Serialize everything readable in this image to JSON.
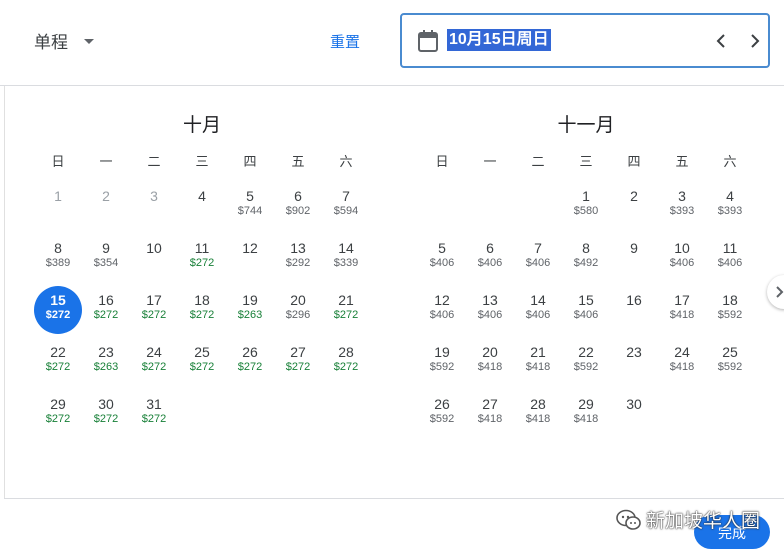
{
  "header": {
    "trip_type": "单程",
    "reset_label": "重置",
    "selected_date": "10月15日周日"
  },
  "weekdays": [
    "日",
    "一",
    "二",
    "三",
    "四",
    "五",
    "六"
  ],
  "months": [
    {
      "title": "十月",
      "first_weekday": 0,
      "days": [
        {
          "day": "1",
          "price": "",
          "past": true
        },
        {
          "day": "2",
          "price": "",
          "past": true
        },
        {
          "day": "3",
          "price": "",
          "past": true
        },
        {
          "day": "4",
          "price": ""
        },
        {
          "day": "5",
          "price": "$744"
        },
        {
          "day": "6",
          "price": "$902"
        },
        {
          "day": "7",
          "price": "$594"
        },
        {
          "day": "8",
          "price": "$389"
        },
        {
          "day": "9",
          "price": "$354"
        },
        {
          "day": "10",
          "price": ""
        },
        {
          "day": "11",
          "price": "$272",
          "low": true
        },
        {
          "day": "12",
          "price": ""
        },
        {
          "day": "13",
          "price": "$292"
        },
        {
          "day": "14",
          "price": "$339"
        },
        {
          "day": "15",
          "price": "$272",
          "selected": true
        },
        {
          "day": "16",
          "price": "$272",
          "low": true
        },
        {
          "day": "17",
          "price": "$272",
          "low": true
        },
        {
          "day": "18",
          "price": "$272",
          "low": true
        },
        {
          "day": "19",
          "price": "$263",
          "low": true
        },
        {
          "day": "20",
          "price": "$296"
        },
        {
          "day": "21",
          "price": "$272",
          "low": true
        },
        {
          "day": "22",
          "price": "$272",
          "low": true
        },
        {
          "day": "23",
          "price": "$263",
          "low": true
        },
        {
          "day": "24",
          "price": "$272",
          "low": true
        },
        {
          "day": "25",
          "price": "$272",
          "low": true
        },
        {
          "day": "26",
          "price": "$272",
          "low": true
        },
        {
          "day": "27",
          "price": "$272",
          "low": true
        },
        {
          "day": "28",
          "price": "$272",
          "low": true
        },
        {
          "day": "29",
          "price": "$272",
          "low": true
        },
        {
          "day": "30",
          "price": "$272",
          "low": true
        },
        {
          "day": "31",
          "price": "$272",
          "low": true
        }
      ]
    },
    {
      "title": "十一月",
      "first_weekday": 3,
      "days": [
        {
          "day": "1",
          "price": "$580"
        },
        {
          "day": "2",
          "price": ""
        },
        {
          "day": "3",
          "price": "$393"
        },
        {
          "day": "4",
          "price": "$393"
        },
        {
          "day": "5",
          "price": "$406"
        },
        {
          "day": "6",
          "price": "$406"
        },
        {
          "day": "7",
          "price": "$406"
        },
        {
          "day": "8",
          "price": "$492"
        },
        {
          "day": "9",
          "price": ""
        },
        {
          "day": "10",
          "price": "$406"
        },
        {
          "day": "11",
          "price": "$406"
        },
        {
          "day": "12",
          "price": "$406"
        },
        {
          "day": "13",
          "price": "$406"
        },
        {
          "day": "14",
          "price": "$406"
        },
        {
          "day": "15",
          "price": "$406"
        },
        {
          "day": "16",
          "price": ""
        },
        {
          "day": "17",
          "price": "$418"
        },
        {
          "day": "18",
          "price": "$592"
        },
        {
          "day": "19",
          "price": "$592"
        },
        {
          "day": "20",
          "price": "$418"
        },
        {
          "day": "21",
          "price": "$418"
        },
        {
          "day": "22",
          "price": "$592"
        },
        {
          "day": "23",
          "price": ""
        },
        {
          "day": "24",
          "price": "$418"
        },
        {
          "day": "25",
          "price": "$592"
        },
        {
          "day": "26",
          "price": "$592"
        },
        {
          "day": "27",
          "price": "$418"
        },
        {
          "day": "28",
          "price": "$418"
        },
        {
          "day": "29",
          "price": "$418"
        },
        {
          "day": "30",
          "price": ""
        }
      ]
    }
  ],
  "footer": {
    "done_label": "完成"
  },
  "watermark": {
    "text": "新加坡华人圈"
  },
  "colors": {
    "accent": "#1a73e8",
    "low_price": "#188038",
    "selection_highlight": "#3367d6"
  }
}
